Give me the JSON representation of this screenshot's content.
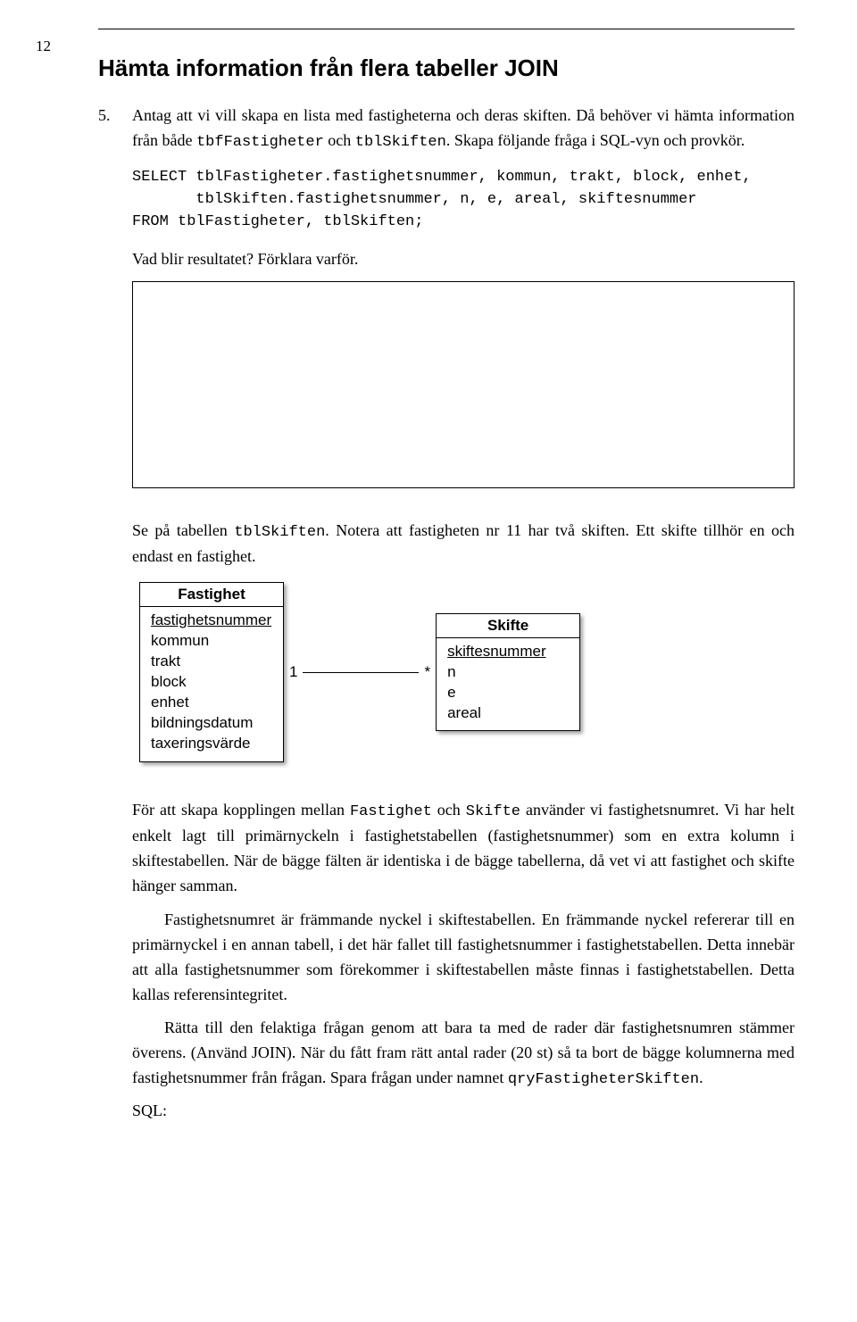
{
  "page_number": "12",
  "section_title": "Hämta information från flera tabeller JOIN",
  "item_number": "5.",
  "p1a": "Antag att vi vill skapa en lista med fastigheterna och deras skiften. Då behöver vi hämta information från både ",
  "p1_code1": "tbfFastigheter",
  "p1_mid": " och ",
  "p1_code2": "tblSkiften",
  "p1b": ". Skapa följande fråga i SQL-vyn och provkör.",
  "sql1": "SELECT tblFastigheter.fastighetsnummer, kommun, trakt, block, enhet,\n       tblSkiften.fastighetsnummer, n, e, areal, skiftesnummer\nFROM tblFastigheter, tblSkiften;",
  "q1": "Vad blir resultatet? Förklara varför.",
  "p2a": "Se på tabellen ",
  "p2_code": "tblSkiften",
  "p2b": ". Notera att fastigheten nr 11 har två skiften. Ett skifte tillhör en och endast en fastighet.",
  "er": {
    "left": {
      "title": "Fastighet",
      "attrs": [
        "fastighetsnummer",
        "kommun",
        "trakt",
        "block",
        "enhet",
        "bildningsdatum",
        "taxeringsvärde"
      ]
    },
    "card_left": "1",
    "card_right": "*",
    "right": {
      "title": "Skifte",
      "attrs": [
        "skiftesnummer",
        "n",
        "e",
        "areal"
      ]
    }
  },
  "p3a": "För att skapa kopplingen mellan ",
  "p3_code1": "Fastighet",
  "p3_mid": " och ",
  "p3_code2": "Skifte",
  "p3b": " använder vi fastighetsnumret. Vi har helt enkelt lagt till primärnyckeln i fastighetstabellen (fastighetsnummer) som en extra kolumn i skiftestabellen. När de bägge fälten är identiska i de bägge tabellerna, då vet vi att fastighet och skifte hänger samman.",
  "p4": "Fastighetsnumret är främmande nyckel i skiftestabellen. En främmande nyckel refererar till en primärnyckel i en annan tabell, i det här fallet till fastighetsnummer i fastighetstabellen. Detta innebär att alla fastighetsnummer som förekommer i skiftestabellen måste finnas i fastighetstabellen. Detta kallas referensintegritet.",
  "p5a": "Rätta till den felaktiga frågan genom att bara ta med de rader där fastighetsnumren stämmer överens. (Använd JOIN). När du fått fram rätt antal rader (20 st) så ta bort de bägge kolumnerna med fastighetsnummer från frågan. Spara frågan under namnet ",
  "p5_code": "qryFastigheterSkiften",
  "p5b": ".",
  "sql_label": "SQL:"
}
